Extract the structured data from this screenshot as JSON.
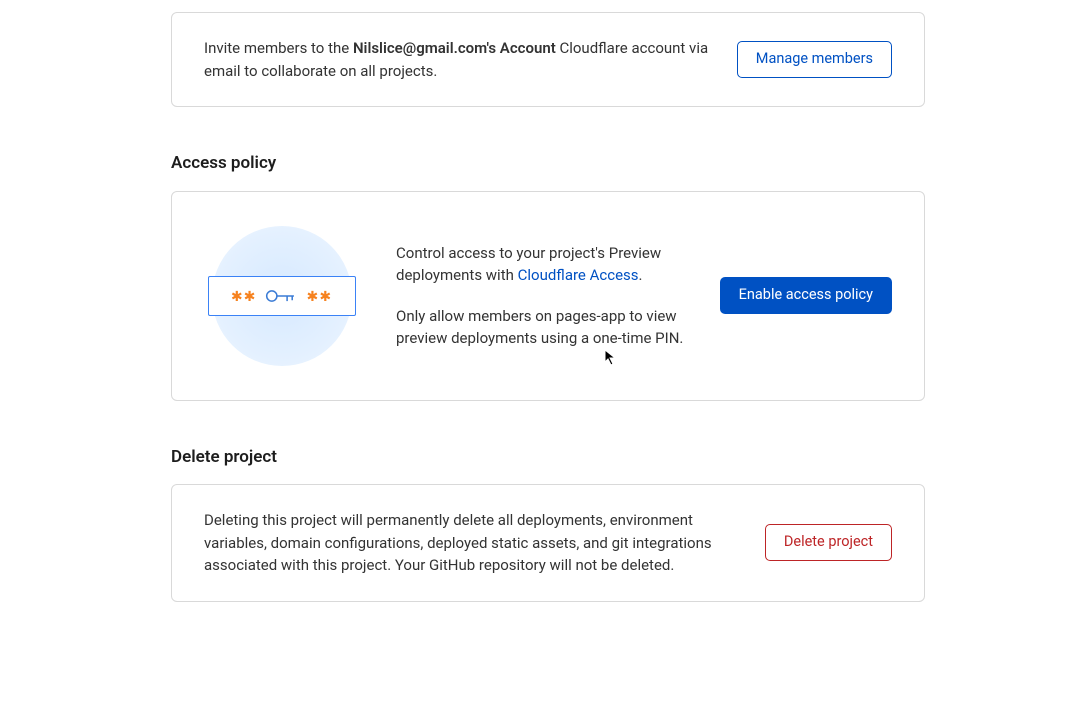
{
  "invite": {
    "prefix": "Invite members to the ",
    "account": "Nilslice@gmail.com's Account",
    "suffix": " Cloudflare account via email to collaborate on all projects.",
    "button": "Manage members"
  },
  "access": {
    "title": "Access policy",
    "para1_prefix": "Control access to your project's Preview deployments with ",
    "para1_link": "Cloudflare Access",
    "para1_suffix": ".",
    "para2": "Only allow members on pages-app to view preview deployments using a one-time PIN.",
    "button": "Enable access policy"
  },
  "delete": {
    "title": "Delete project",
    "text": "Deleting this project will permanently delete all deployments, environment variables, domain configurations, deployed static assets, and git integrations associated with this project. Your GitHub repository will not be deleted.",
    "button": "Delete project"
  },
  "illustration": {
    "asterisk": "✱✱",
    "asterisk2": "✱✱"
  }
}
